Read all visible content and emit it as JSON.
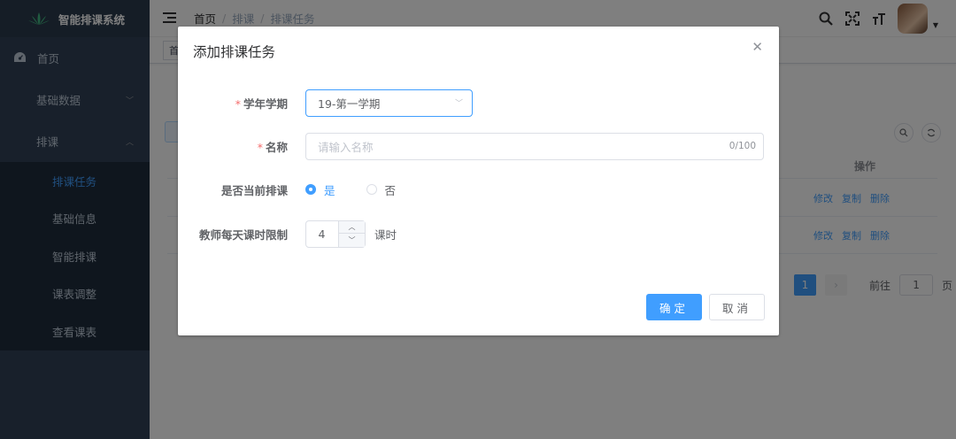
{
  "sidebar": {
    "title": "智能排课系统",
    "items": [
      {
        "label": "首页"
      },
      {
        "label": "基础数据"
      },
      {
        "label": "排课"
      }
    ],
    "submenu": [
      {
        "label": "排课任务"
      },
      {
        "label": "基础信息"
      },
      {
        "label": "智能排课"
      },
      {
        "label": "课表调整"
      },
      {
        "label": "查看课表"
      }
    ]
  },
  "navbar": {
    "breadcrumb": [
      "首页",
      "排课",
      "排课任务"
    ],
    "tag": "首页"
  },
  "table": {
    "op_header": "操作",
    "actions": {
      "edit": "修改",
      "copy": "复制",
      "delete": "删除"
    }
  },
  "pager": {
    "current": "1",
    "goto_label": "前往",
    "goto_value": "1",
    "page_suffix": "页"
  },
  "dialog": {
    "title": "添加排课任务",
    "term_label": "学年学期",
    "term_value": "19-第一学期",
    "name_label": "名称",
    "name_placeholder": "请输入名称",
    "name_counter": "0/100",
    "current_label": "是否当前排课",
    "radio_yes": "是",
    "radio_no": "否",
    "limit_label": "教师每天课时限制",
    "limit_value": "4",
    "limit_unit": "课时",
    "confirm": "确定",
    "cancel": "取消"
  },
  "colors": {
    "primary": "#409eff",
    "sidebar_bg": "#304156",
    "submenu_bg": "#1f2d3d",
    "required": "#f56c6c"
  }
}
